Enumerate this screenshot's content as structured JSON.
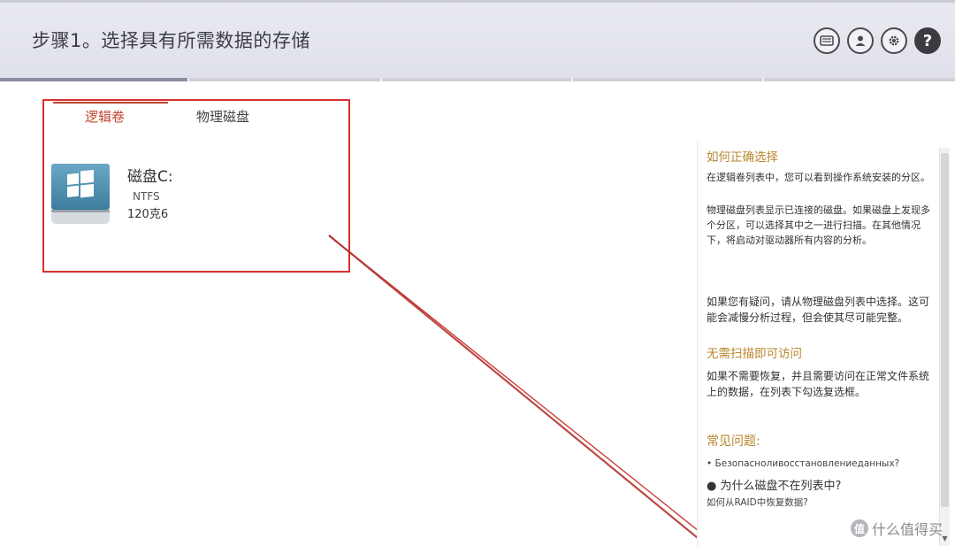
{
  "header": {
    "title": "步骤1。选择具有所需数据的存储",
    "icons": [
      "drive-icon",
      "user-icon",
      "gear-icon",
      "help-icon"
    ],
    "help_glyph": "?"
  },
  "tabs": [
    {
      "label": "逻辑卷",
      "active": true
    },
    {
      "label": "物理磁盘",
      "active": false
    }
  ],
  "disk": {
    "name": "磁盘C:",
    "filesystem": "NTFS",
    "size": "120克6"
  },
  "help_panel": {
    "section1_heading": "如何正确选择",
    "p1": "在逻辑卷列表中，您可以看到操作系统安装的分区。",
    "p2": "物理磁盘列表显示已连接的磁盘。如果磁盘上发现多个分区，可以选择其中之一进行扫描。在其他情况下，将启动对驱动器所有内容的分析。",
    "p3": "如果您有疑问，请从物理磁盘列表中选择。这可能会减慢分析过程，但会使其尽可能完整。",
    "section2_heading": "无需扫描即可访问",
    "p4": "如果不需要恢复，并且需要访问在正常文件系统上的数据，在列表下勾选复选框。",
    "section3_heading": "常见问题:",
    "faq": [
      "• Безопасноливосстановлениеданных?",
      "● 为什么磁盘不在列表中?",
      "如何从RAID中恢复数据?"
    ]
  },
  "watermark": {
    "icon_glyph": "值",
    "text": "什么值得买"
  },
  "colors": {
    "accent_red": "#c2452f",
    "annotation_red": "#d8302f",
    "heading_gold": "#b8862c"
  }
}
